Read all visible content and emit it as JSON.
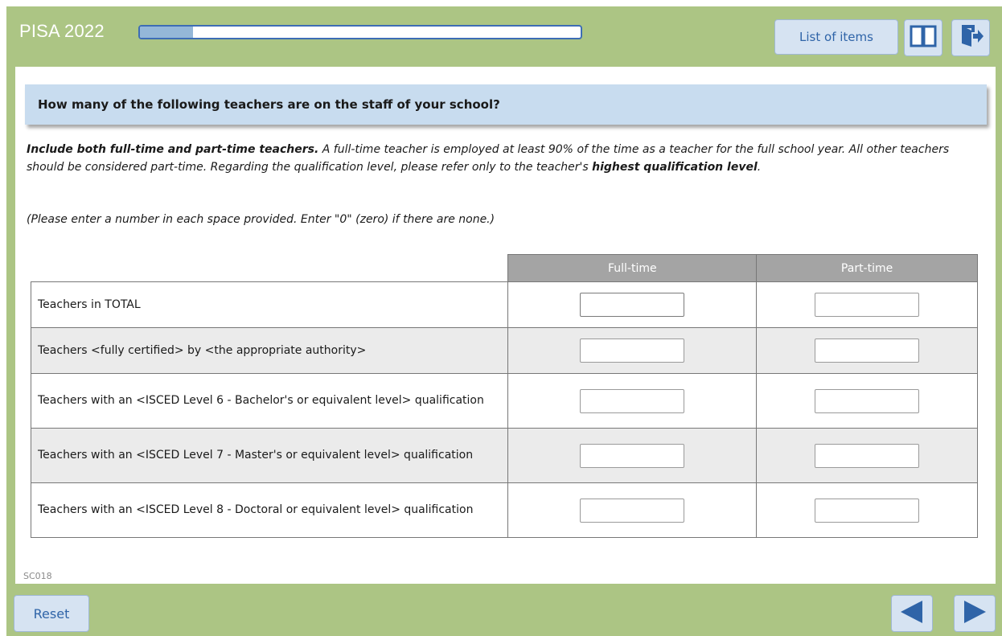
{
  "header": {
    "app_title": "PISA 2022",
    "progress_fraction": 0.12,
    "list_items_label": "List of items",
    "icons": [
      "book-icon",
      "exit-icon"
    ]
  },
  "question": {
    "title": "How many of the following teachers are on the staff of your school?",
    "instructions_bold_1": "Include both full-time and part-time teachers.",
    "instructions_text_1": " A full-time teacher is employed at least 90% of the time as a teacher for the full school year. All other teachers should be considered part-time. Regarding the qualification level, please refer only to the teacher's ",
    "instructions_bold_2": "highest qualification level",
    "instructions_text_2": ".",
    "note": "(Please enter a number in each space provided. Enter \"0\" (zero) if there are none.)"
  },
  "table": {
    "columns": [
      "Full-time",
      "Part-time"
    ],
    "rows": [
      {
        "label": "Teachers in TOTAL",
        "full_time": "",
        "part_time": ""
      },
      {
        "label": "Teachers <fully certified> by <the appropriate authority>",
        "full_time": "",
        "part_time": ""
      },
      {
        "label": "Teachers with an <ISCED Level 6 - Bachelor's or equivalent level> qualification",
        "full_time": "",
        "part_time": ""
      },
      {
        "label": "Teachers with an <ISCED Level 7 - Master's or equivalent level> qualification",
        "full_time": "",
        "part_time": ""
      },
      {
        "label": "Teachers with an <ISCED Level 8 - Doctoral or equivalent level> qualification",
        "full_time": "",
        "part_time": ""
      }
    ]
  },
  "item_code": "SC018",
  "footer": {
    "reset_label": "Reset",
    "icons": [
      "back-arrow-icon",
      "next-arrow-icon"
    ]
  },
  "colors": {
    "frame_green": "#acc584",
    "question_blue": "#c8dcef",
    "button_blue": "#d6e3f2",
    "accent_blue": "#2f64a8",
    "header_gray": "#a4a4a4"
  }
}
